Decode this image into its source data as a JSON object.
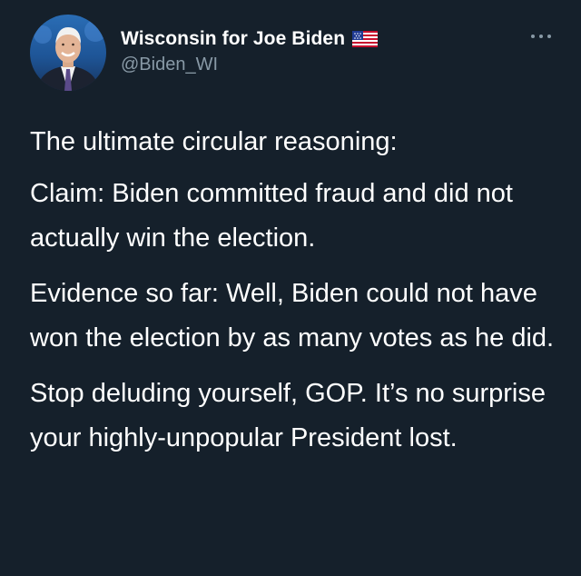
{
  "tweet": {
    "author": {
      "display_name": "Wisconsin for Joe Biden",
      "handle": "@Biden_WI",
      "flag_icon": "us-flag-icon",
      "avatar_icon": "avatar-photo"
    },
    "more_icon": "more-options-icon",
    "paragraphs": [
      "The ultimate circular reasoning:",
      "Claim: Biden committed fraud and did not actually win the election.",
      "Evidence so far: Well, Biden could not have won the election by as many votes as he did.",
      "Stop deluding yourself, GOP. It’s no surprise your highly-unpopular President lost."
    ]
  },
  "colors": {
    "background": "#15202b",
    "text": "#ffffff",
    "secondary_text": "#8899a6"
  }
}
